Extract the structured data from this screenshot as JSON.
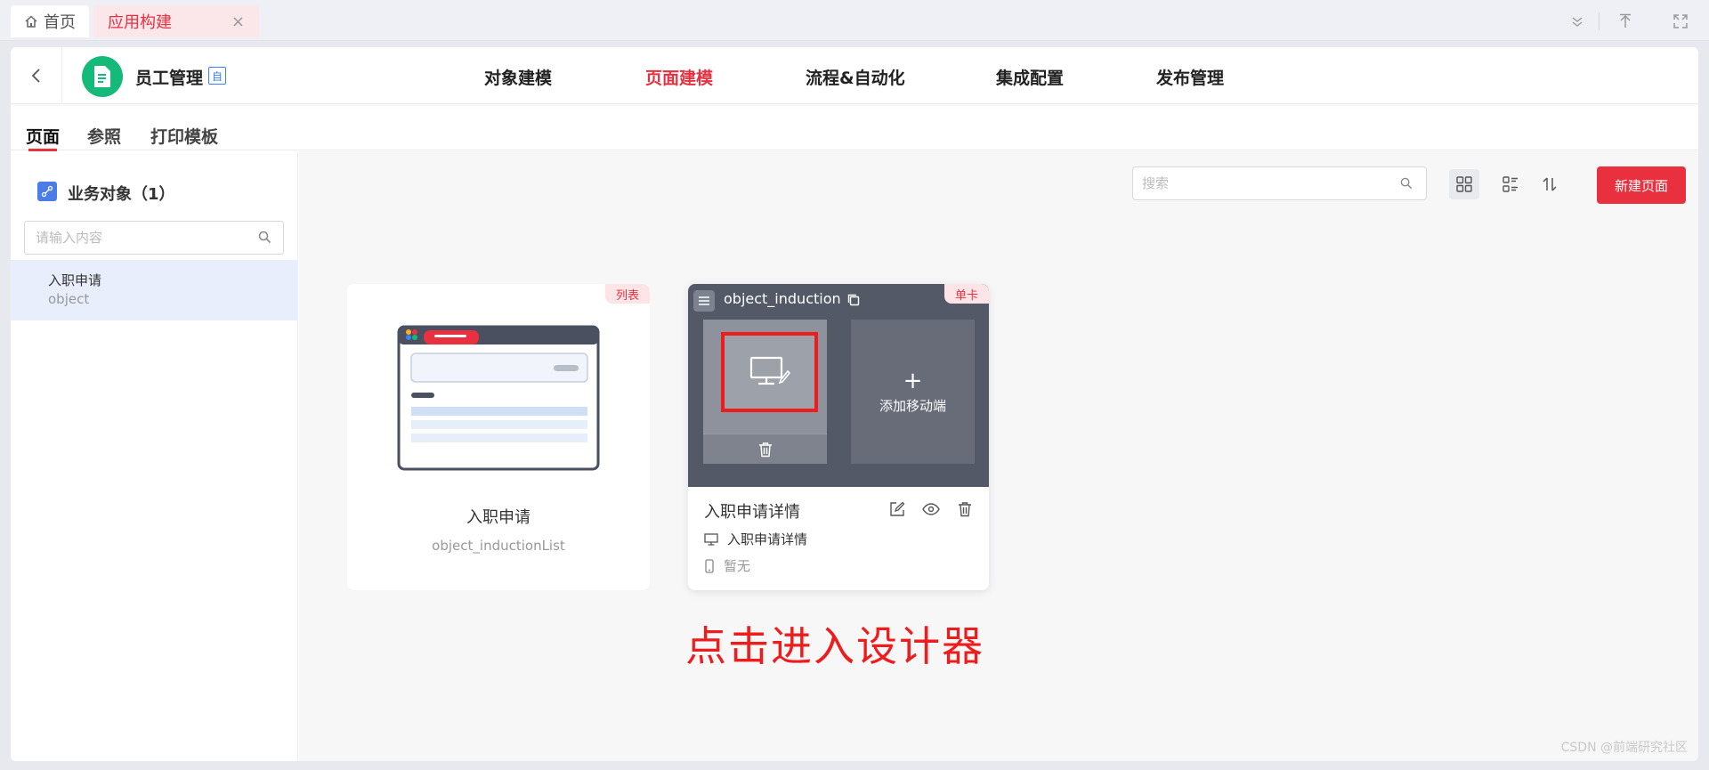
{
  "tabs": {
    "home": "首页",
    "active": "应用构建",
    "close": "×"
  },
  "app": {
    "name": "员工管理",
    "badge": "自"
  },
  "nav": [
    "对象建模",
    "页面建模",
    "流程&自动化",
    "集成配置",
    "发布管理"
  ],
  "nav_active_index": 1,
  "subtabs": [
    "页面",
    "参照",
    "打印模板"
  ],
  "left_panel": {
    "title": "业务对象（1）",
    "search_placeholder": "请输入内容",
    "items": [
      {
        "name": "入职申请",
        "code": "object"
      }
    ]
  },
  "toolbar": {
    "search_placeholder": "搜索",
    "new_button": "新建页面"
  },
  "cards": [
    {
      "tag": "列表",
      "title": "入职申请",
      "code": "object_inductionList"
    },
    {
      "tag": "单卡",
      "code": "object_induction",
      "add_mobile": "添加移动端",
      "title": "入职申请详情",
      "pc_page": "入职申请详情",
      "mobile_page": "暂无"
    }
  ],
  "annotation": "点击进入设计器",
  "watermark": "CSDN @前端研究社区",
  "colors": {
    "accent": "#e8303f",
    "app_logo": "#15b979",
    "highlight_box": "#ee1c1c",
    "card_dark": "#545968"
  },
  "icons": {
    "home": "home-icon",
    "back": "chevron-left-icon",
    "search": "search-icon",
    "grid_view": "grid-view-icon",
    "list_view": "list-view-icon",
    "sort": "sort-icon",
    "edit": "edit-icon",
    "preview": "eye-icon",
    "delete": "trash-icon",
    "desktop": "desktop-icon",
    "mobile": "mobile-icon"
  }
}
